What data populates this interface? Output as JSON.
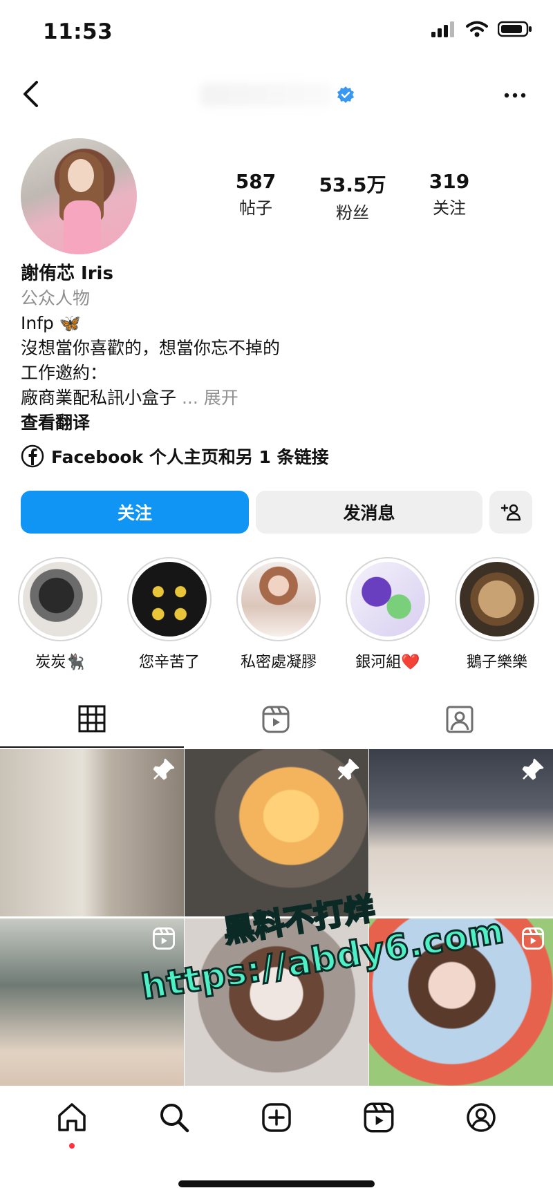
{
  "status_bar": {
    "time": "11:53"
  },
  "header": {
    "username": "",
    "verified": true
  },
  "profile": {
    "stats": [
      {
        "value": "587",
        "label": "帖子"
      },
      {
        "value": "53.5万",
        "label": "粉丝"
      },
      {
        "value": "319",
        "label": "关注"
      }
    ],
    "name": "謝侑芯 Iris",
    "category": "公众人物",
    "bio_lines": [
      "Infp 🦋",
      "沒想當你喜歡的，想當你忘不掉的",
      "工作邀約：",
      "廠商業配私訊小盒子"
    ],
    "expand_label": "... 展开",
    "translate_label": "查看翻译",
    "link_text": "Facebook 个人主页和另 1 条链接"
  },
  "actions": {
    "follow_label": "关注",
    "message_label": "发消息"
  },
  "highlights": [
    {
      "label": "炭炭🐈‍⬛",
      "color": "#3a3a3a"
    },
    {
      "label": "您辛苦了",
      "color": "#1a1a1a"
    },
    {
      "label": "私密處凝膠",
      "color": "#d9b7a8"
    },
    {
      "label": "銀河組❤️",
      "color": "#9a88d6"
    },
    {
      "label": "鵝子樂樂",
      "color": "#a07a52"
    }
  ],
  "tabs": [
    "grid-icon",
    "reels-icon",
    "tagged-icon"
  ],
  "grid": [
    {
      "badge": "pin-icon",
      "colors": [
        "#c9c2b7",
        "#e6e1d8",
        "#8b8176"
      ]
    },
    {
      "badge": "pin-icon",
      "colors": [
        "#4d4a45",
        "#f4b45d",
        "#d78a3c"
      ]
    },
    {
      "badge": "pin-icon",
      "colors": [
        "#3b3f4a",
        "#dcd2c8",
        "#e9e4df"
      ]
    },
    {
      "badge": "reel-icon",
      "colors": [
        "#6f7a74",
        "#c7cbc4",
        "#e2d2c3"
      ]
    },
    {
      "badge": "",
      "colors": [
        "#d8d2cf",
        "#a29891",
        "#efe6e2"
      ]
    },
    {
      "badge": "reel-icon",
      "colors": [
        "#b9d3ea",
        "#f1d7cc",
        "#e7624c"
      ]
    }
  ],
  "watermark": {
    "line1": "黑料不打烊",
    "line2": "https://abdy6.com"
  },
  "bottom_nav": [
    "home-icon",
    "search-icon",
    "create-icon",
    "reels-icon",
    "profile-icon"
  ]
}
